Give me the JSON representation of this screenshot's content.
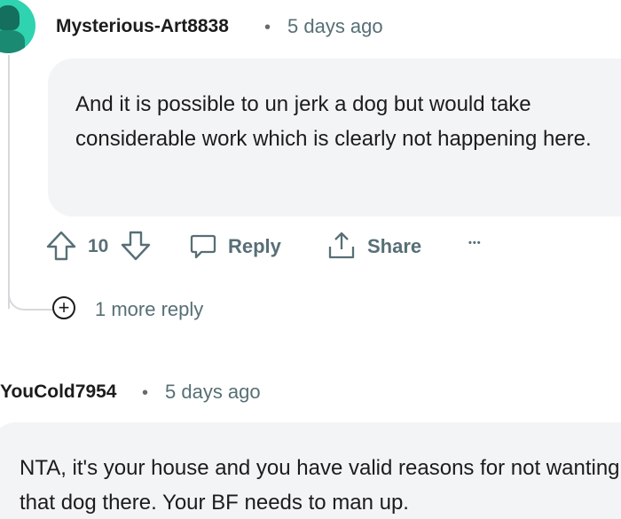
{
  "comments": [
    {
      "username": "Mysterious-Art8838",
      "separator": "•",
      "time": "5 days ago",
      "body": "And it is possible to un jerk a dog but would take considerable work which is clearly not happening here.",
      "votes": "10",
      "reply_label": "Reply",
      "share_label": "Share",
      "more_label": "•••",
      "more_replies_label": "1 more reply",
      "more_replies_sign": "+"
    },
    {
      "username": "YouCold7954",
      "separator": "•",
      "time": "5 days ago",
      "body": "NTA, it's your house and you have valid reasons for not wanting that dog there. Your BF needs to man up."
    }
  ],
  "colors": {
    "avatar": "#2fd3b0",
    "muted_text": "#576f76",
    "bubble_bg": "#f3f4f6"
  },
  "icons": [
    "upvote-icon",
    "downvote-icon",
    "reply-bubble-icon",
    "share-icon",
    "overflow-menu-icon",
    "plus-circle-icon"
  ]
}
